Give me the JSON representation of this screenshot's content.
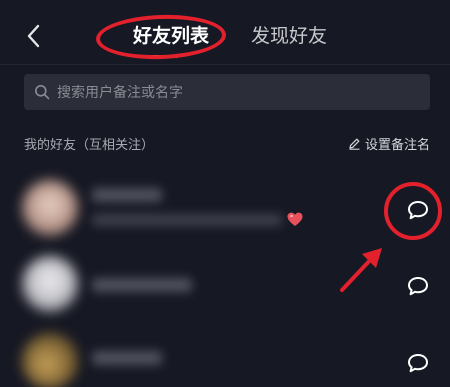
{
  "header": {
    "back_icon": "chevron-left-icon",
    "tabs": [
      {
        "label": "好友列表",
        "active": true
      },
      {
        "label": "发现好友",
        "active": false
      }
    ],
    "active_underline_color": "#f5c842"
  },
  "search": {
    "icon": "search-icon",
    "placeholder": "搜索用户备注或名字"
  },
  "section": {
    "title": "我的好友（互相关注）",
    "remark_icon": "pencil-icon",
    "remark_label": "设置备注名"
  },
  "friends": [
    {
      "name_blurred": true,
      "has_heart_emoji": true,
      "action_icon": "chat-bubble-icon",
      "highlighted": true
    },
    {
      "name_blurred": true,
      "has_heart_emoji": false,
      "action_icon": "chat-bubble-icon",
      "highlighted": false
    },
    {
      "name_blurred": true,
      "has_heart_emoji": false,
      "action_icon": "chat-bubble-icon",
      "highlighted": false
    }
  ],
  "annotation_color": "#e3212d",
  "colors": {
    "background": "#161823",
    "search_background": "#2b2d39",
    "emoji_heart": "#e8505b"
  }
}
